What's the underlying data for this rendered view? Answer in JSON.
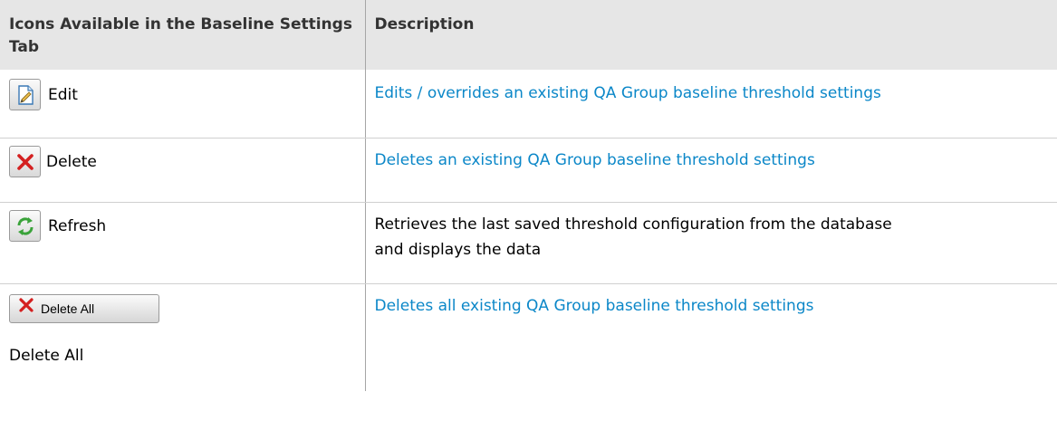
{
  "table": {
    "headers": [
      "Icons Available in the Baseline Settings Tab",
      "Description"
    ],
    "rows": [
      {
        "icon": "edit-icon",
        "label": "Edit",
        "description": "Edits / overrides an existing QA Group baseline threshold settings",
        "description_is_link": true
      },
      {
        "icon": "delete-icon",
        "label": "Delete",
        "description": "Deletes an existing QA Group baseline threshold settings",
        "description_is_link": true
      },
      {
        "icon": "refresh-icon",
        "label": "Refresh",
        "description": "Retrieves the last saved threshold configuration from the database and displays the data",
        "description_is_link": false
      },
      {
        "icon": "delete-all-icon",
        "button_text": "Delete All",
        "label": "Delete All",
        "description": "Deletes all existing QA Group baseline threshold settings",
        "description_is_link": true
      }
    ]
  },
  "colors": {
    "header_bg": "#e6e6e6",
    "link": "#0b87c8",
    "delete_red": "#d42020",
    "refresh_green": "#3aa33a"
  }
}
